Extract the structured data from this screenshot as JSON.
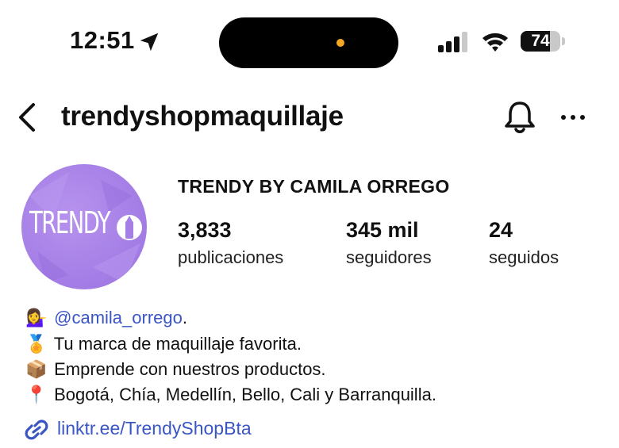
{
  "status_bar": {
    "time": "12:51",
    "battery": "74",
    "battery_level": 0.74,
    "location_icon": "location-arrow-icon",
    "signal_icon": "cellular-signal-icon",
    "wifi_icon": "wifi-icon"
  },
  "header": {
    "username": "trendyshopmaquillaje",
    "back_icon": "chevron-left-icon",
    "bell_icon": "bell-icon",
    "more_icon": "more-horizontal-icon"
  },
  "profile": {
    "avatar_text": "TRENDY",
    "avatar_color": "#a57fe6",
    "full_name": "TRENDY BY CAMILA ORREGO",
    "stats": [
      {
        "value": "3,833",
        "label": "publicaciones"
      },
      {
        "value": "345 mil",
        "label": "seguidores"
      },
      {
        "value": "24",
        "label": "seguidos"
      }
    ]
  },
  "bio": {
    "lines": [
      {
        "emoji": "💁‍♀️",
        "text": "",
        "mention": "@camila_orrego",
        "suffix": "."
      },
      {
        "emoji": "🏅",
        "text": "Tu marca de maquillaje favorita."
      },
      {
        "emoji": "📦",
        "text": "Emprende con nuestros productos."
      },
      {
        "emoji": "📍",
        "text": "Bogotá, Chía, Medellín, Bello, Cali y Barranquilla."
      }
    ],
    "link_icon": "link-icon",
    "link": "linktr.ee/TrendyShopBta"
  },
  "colors": {
    "link": "#3a56c4",
    "avatar": "#a57fe6"
  }
}
